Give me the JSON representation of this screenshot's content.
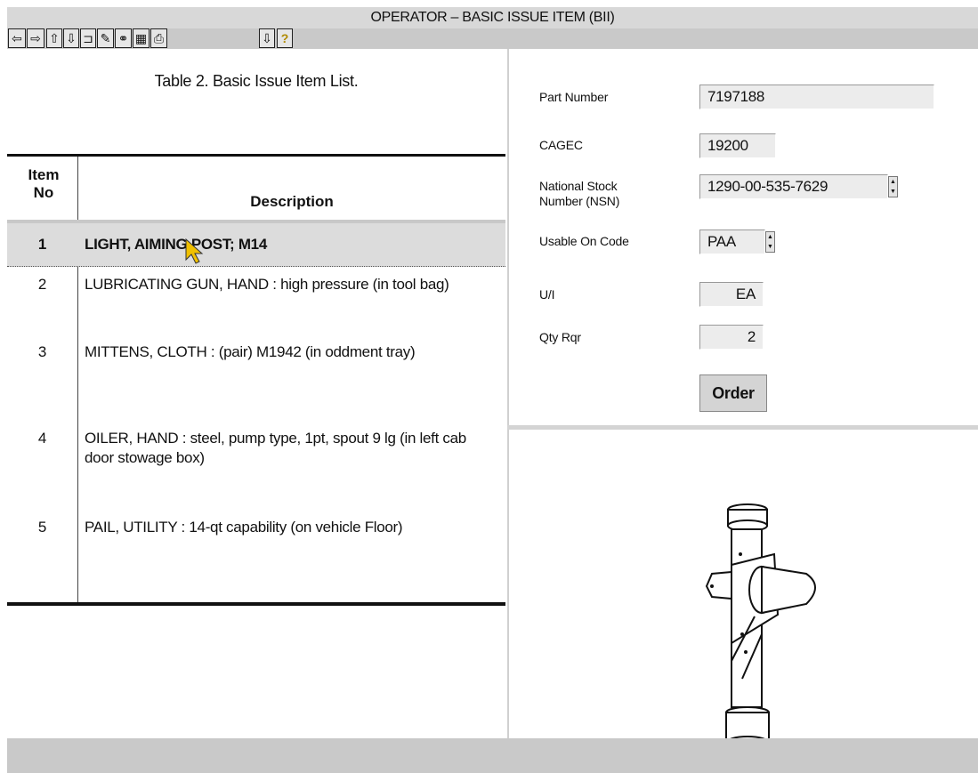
{
  "window": {
    "title": "OPERATOR – BASIC ISSUE ITEM (BII)"
  },
  "toolbar": {
    "buttons": [
      {
        "icon": "arrow-left-icon",
        "glyph": "⇦"
      },
      {
        "icon": "arrow-right-icon",
        "glyph": "⇨"
      },
      {
        "icon": "arrow-up-icon",
        "glyph": "⇧"
      },
      {
        "icon": "arrow-down-icon",
        "glyph": "⇩"
      },
      {
        "icon": "return-icon",
        "glyph": "⊐"
      },
      {
        "icon": "pen-icon",
        "glyph": "✎"
      },
      {
        "icon": "binoculars-icon",
        "glyph": "⚭"
      },
      {
        "icon": "calculator-icon",
        "glyph": "▦"
      },
      {
        "icon": "print-icon",
        "glyph": "⎙"
      },
      {
        "icon": "bookmark-icon",
        "glyph": "⇩"
      },
      {
        "icon": "help-icon",
        "glyph": "?"
      }
    ]
  },
  "table": {
    "title": "Table 2. Basic Issue Item List.",
    "header_item_line1": "Item",
    "header_item_line2": "No",
    "header_description": "Description",
    "rows": [
      {
        "no": "1",
        "description": "LIGHT, AIMING POST; M14"
      },
      {
        "no": "2",
        "description": "LUBRICATING GUN, HAND : high pressure (in tool bag)"
      },
      {
        "no": "3",
        "description": "MITTENS, CLOTH : (pair) M1942 (in oddment tray)"
      },
      {
        "no": "4",
        "description": "OILER, HAND : steel, pump type, 1pt, spout 9 lg (in left cab door stowage box)"
      },
      {
        "no": "5",
        "description": "PAIL, UTILITY : 14-qt capability (on vehicle Floor)"
      }
    ],
    "selected_row": 1
  },
  "details": {
    "part_number_label": "Part Number",
    "part_number": "7197188",
    "cagec_label": "CAGEC",
    "cagec": "19200",
    "nsn_label_line1": "National Stock",
    "nsn_label_line2": "Number (NSN)",
    "nsn": "1290-00-535-7629",
    "usable_on_label": "Usable On Code",
    "usable_on": "PAA",
    "ui_label": "U/I",
    "ui": "EA",
    "qty_label": "Qty Rqr",
    "qty": "2",
    "order_label": "Order"
  }
}
